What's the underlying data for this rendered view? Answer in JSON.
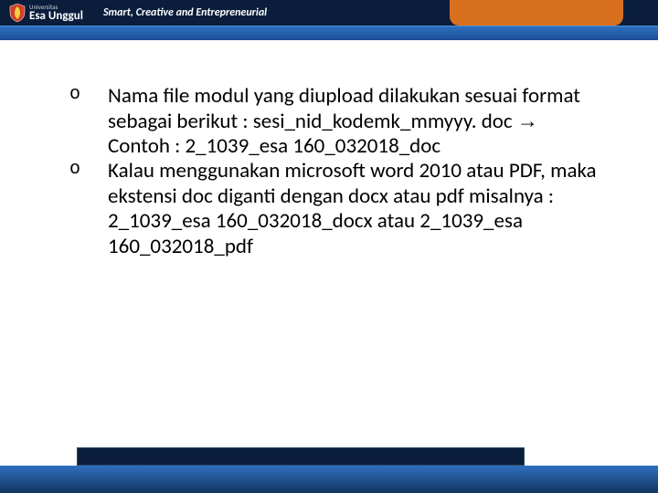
{
  "header": {
    "uni_label": "Universitas",
    "brand": "Esa Unggul",
    "slogan": "Smart, Creative and Entrepreneurial"
  },
  "content": {
    "items": [
      {
        "bullet": "o",
        "text_a": "Nama file modul yang diupload dilakukan sesuai format sebagai berikut : sesi_nid_kodemk_mmyyy. doc ",
        "arrow": "→",
        "text_b": " Contoh : 2_1039_esa 160_032018_doc"
      },
      {
        "bullet": "o",
        "text_a": "Kalau menggunakan microsoft word 2010 atau PDF, maka ekstensi doc diganti dengan docx atau pdf misalnya : 2_1039_esa 160_032018_docx  atau 2_1039_esa 160_032018_pdf",
        "arrow": "",
        "text_b": ""
      }
    ]
  }
}
